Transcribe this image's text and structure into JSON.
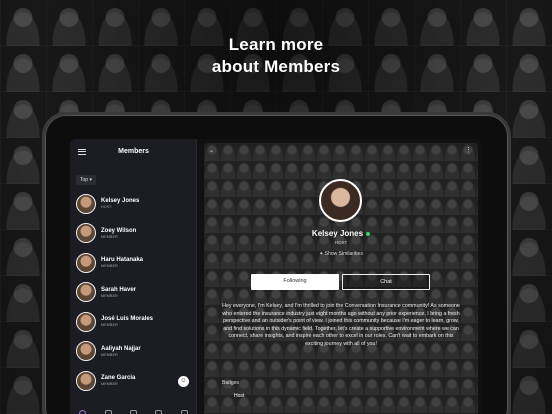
{
  "headline": {
    "line1": "Learn more",
    "line2": "about Members"
  },
  "sidebar": {
    "title": "Members",
    "filter": "Top ▾",
    "members": [
      {
        "name": "Kelsey Jones",
        "role": "HOST"
      },
      {
        "name": "Zoey Wilson",
        "role": "MEMBER"
      },
      {
        "name": "Haru Hatanaka",
        "role": "MEMBER"
      },
      {
        "name": "Sarah Haver",
        "role": "MEMBER"
      },
      {
        "name": "José Luis Morales",
        "role": "MEMBER"
      },
      {
        "name": "Aaliyah Najjar",
        "role": "MEMBER"
      },
      {
        "name": "Zane Garcia",
        "role": "MEMBER"
      }
    ]
  },
  "profile": {
    "name": "Kelsey Jones",
    "role": "HOST",
    "similarities": "Show Similarities",
    "following_label": "Following",
    "chat_label": "Chat",
    "bio": "Hey everyone, I'm Kelsey, and I'm thrilled to join the Conversation Insurance community! As someone who entered the insurance industry just eight months ago without any prior experience, I bring a fresh perspective and an outsider's point of view. I joined this community because I'm eager to learn, grow, and find solutions in this dynamic field. Together, let's create a supportive environment where we can connect, share insights, and inspire each other to excel in our roles. Can't wait to embark on this exciting journey with all of you!",
    "badges_label": "Badges",
    "badge": "Host"
  },
  "colors": {
    "online": "#3bd16f",
    "active_nav": "#a57ad6"
  }
}
